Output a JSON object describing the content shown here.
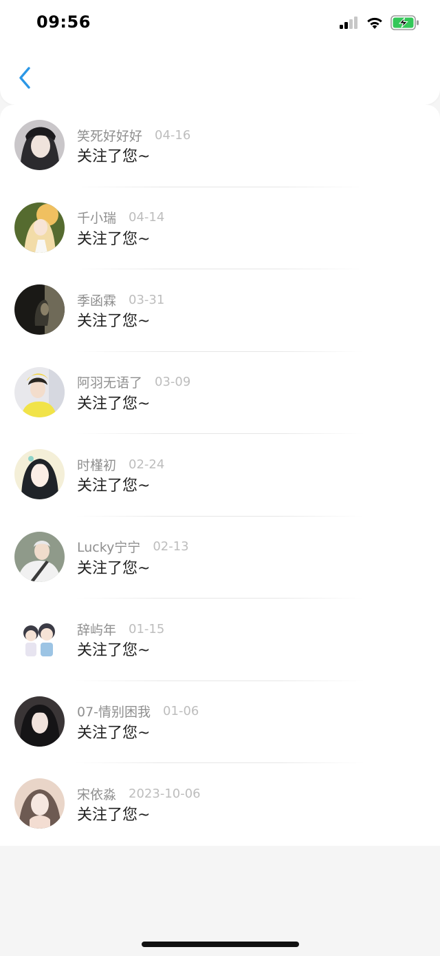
{
  "status_bar": {
    "time": "09:56",
    "signal_icon": "cellular-signal-icon",
    "wifi_icon": "wifi-icon",
    "battery_icon": "battery-charging-icon",
    "battery_color": "#34c759"
  },
  "header": {
    "back_icon": "chevron-left-icon",
    "accent_color": "#2b97e6"
  },
  "items": [
    {
      "name": "笑死好好好",
      "date": "04-16",
      "text": "关注了您~",
      "avatar_colors": [
        "#c9c6c9",
        "#2b2a2e"
      ]
    },
    {
      "name": "千小瑞",
      "date": "04-14",
      "text": "关注了您~",
      "avatar_colors": [
        "#e8a848",
        "#556b2f"
      ]
    },
    {
      "name": "季函霖",
      "date": "03-31",
      "text": "关注了您~",
      "avatar_colors": [
        "#1a1916",
        "#6f6a58"
      ]
    },
    {
      "name": "阿羽无语了",
      "date": "03-09",
      "text": "关注了您~",
      "avatar_colors": [
        "#e8e8ec",
        "#f1e349"
      ]
    },
    {
      "name": "时槿初",
      "date": "02-24",
      "text": "关注了您~",
      "avatar_colors": [
        "#f4efd8",
        "#1f2328"
      ]
    },
    {
      "name": "Lucky宁宁",
      "date": "02-13",
      "text": "关注了您~",
      "avatar_colors": [
        "#8f9a8a",
        "#f1f1f1"
      ]
    },
    {
      "name": "辞屿年",
      "date": "01-15",
      "text": "关注了您~",
      "avatar_colors": [
        "#ffffff",
        "#3b3b45"
      ]
    },
    {
      "name": "07-情别困我",
      "date": "01-06",
      "text": "关注了您~",
      "avatar_colors": [
        "#3a3536",
        "#151416"
      ]
    },
    {
      "name": "宋依淼",
      "date": "2023-10-06",
      "text": "关注了您~",
      "avatar_colors": [
        "#e9d5c8",
        "#6d5a52"
      ]
    }
  ]
}
